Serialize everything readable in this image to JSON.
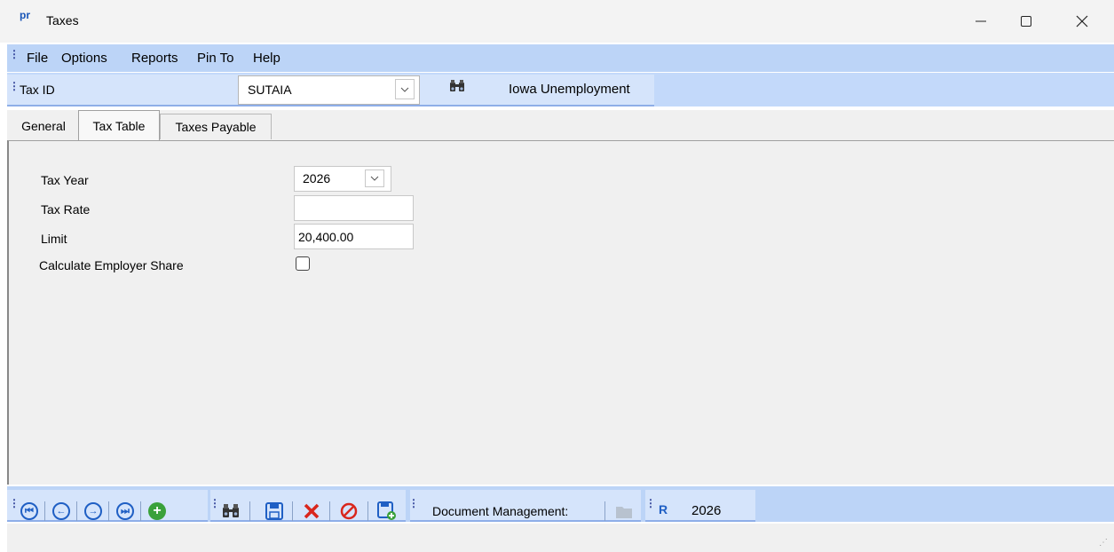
{
  "window": {
    "app_icon_text": "pr",
    "title": "Taxes"
  },
  "menu": {
    "items": [
      "File",
      "Options",
      "Reports",
      "Pin To",
      "Help"
    ]
  },
  "taxid_bar": {
    "label": "Tax ID",
    "value": "SUTAIA",
    "description": "Iowa Unemployment"
  },
  "tabs": [
    {
      "label": "General",
      "active": false
    },
    {
      "label": "Tax Table",
      "active": true
    },
    {
      "label": "Taxes Payable",
      "active": false
    }
  ],
  "form": {
    "tax_year_label": "Tax Year",
    "tax_year_value": "2026",
    "tax_rate_label": "Tax Rate",
    "tax_rate_value": "",
    "limit_label": "Limit",
    "limit_value": "20,400.00",
    "employer_share_label": "Calculate Employer Share",
    "employer_share_checked": false
  },
  "bottom_toolbar": {
    "doc_mgmt_label": "Document Management:",
    "year_value": "2026"
  },
  "colors": {
    "accent": "#1f5fc4",
    "toolbar": "#bcd4f7",
    "delete": "#d9261c",
    "add": "#3aa13a"
  }
}
